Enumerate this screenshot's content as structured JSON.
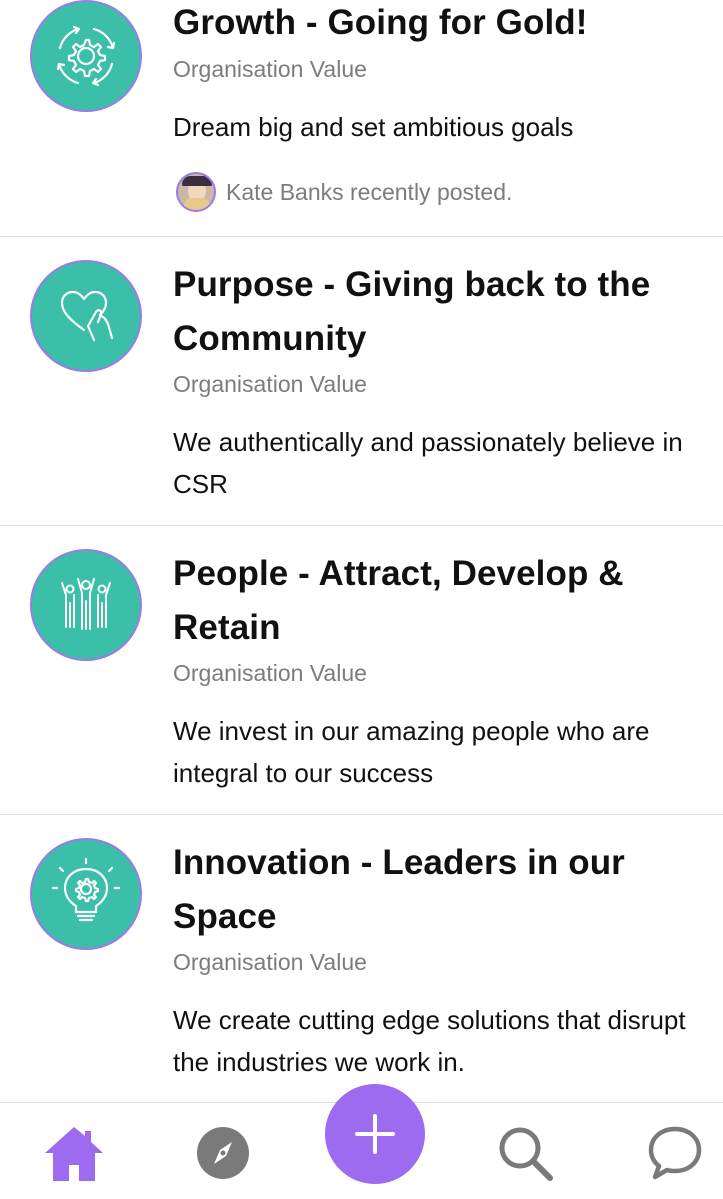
{
  "colors": {
    "accent": "#9c6bf0",
    "icon_bg": "#3bbfa9",
    "icon_ring": "#9b7be6",
    "muted_text": "#7c7c7c",
    "tab_icon": "#7a7a7a"
  },
  "cards": [
    {
      "icon": "growth-cycle-gear-icon",
      "title": "Growth - Going for Gold!",
      "subtitle": "Organisation Value",
      "description": "Dream big and set ambitious goals",
      "recent_activity": "Kate Banks recently posted."
    },
    {
      "icon": "heart-in-hand-icon",
      "title": "Purpose - Giving back to the Community",
      "subtitle": "Organisation Value",
      "description": "We authentically and passionately believe in CSR"
    },
    {
      "icon": "people-celebrating-icon",
      "title": "People - Attract, Develop & Retain",
      "subtitle": "Organisation Value",
      "description": "We invest in our amazing people who are integral to our success"
    },
    {
      "icon": "lightbulb-gear-icon",
      "title": "Innovation - Leaders in our Space",
      "subtitle": "Organisation Value",
      "description": "We create cutting edge solutions that disrupt the industries we work in."
    }
  ],
  "tabbar": {
    "items": [
      "home-icon",
      "compass-icon",
      "plus-icon",
      "search-icon",
      "chat-bubble-icon"
    ],
    "active": "home-icon"
  }
}
